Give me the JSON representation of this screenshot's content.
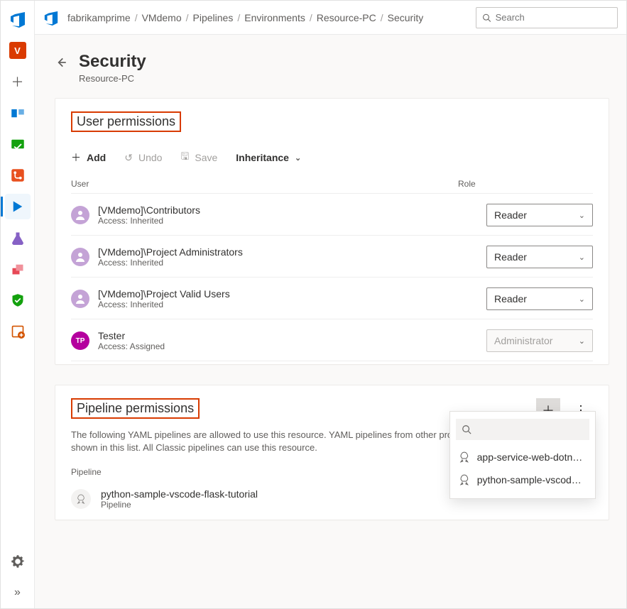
{
  "breadcrumb": [
    "fabrikamprime",
    "VMdemo",
    "Pipelines",
    "Environments",
    "Resource-PC",
    "Security"
  ],
  "search": {
    "placeholder": "Search"
  },
  "page": {
    "title": "Security",
    "subtitle": "Resource-PC"
  },
  "userPerm": {
    "title": "User permissions",
    "toolbar": {
      "add": "Add",
      "undo": "Undo",
      "save": "Save",
      "inherit": "Inheritance"
    },
    "headers": {
      "user": "User",
      "role": "Role"
    },
    "rows": [
      {
        "name": "[VMdemo]\\Contributors",
        "access": "Access: Inherited",
        "role": "Reader",
        "avatar": "group"
      },
      {
        "name": "[VMdemo]\\Project Administrators",
        "access": "Access: Inherited",
        "role": "Reader",
        "avatar": "group"
      },
      {
        "name": "[VMdemo]\\Project Valid Users",
        "access": "Access: Inherited",
        "role": "Reader",
        "avatar": "group"
      },
      {
        "name": "Tester",
        "access": "Access: Assigned",
        "role": "Administrator",
        "avatar": "user",
        "initials": "TP",
        "disabled": true
      }
    ]
  },
  "pipePerm": {
    "title": "Pipeline permissions",
    "desc": "The following YAML pipelines are allowed to use this resource. YAML pipelines from other projects are not shown in this list. All Classic pipelines can use this resource.",
    "colHeader": "Pipeline",
    "row": {
      "name": "python-sample-vscode-flask-tutorial",
      "sub": "Pipeline"
    },
    "callout": {
      "items": [
        "app-service-web-dotnet...",
        "python-sample-vscode-..."
      ]
    }
  },
  "nav": {
    "project_initial": "V"
  }
}
